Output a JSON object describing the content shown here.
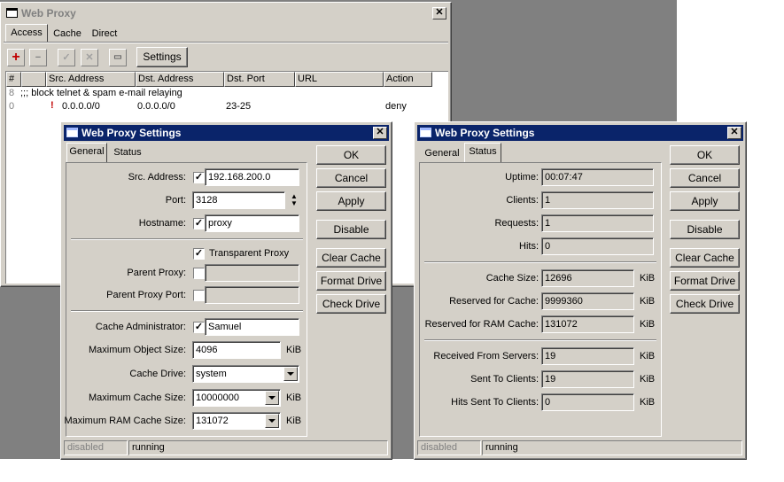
{
  "main_window": {
    "title": "Web Proxy",
    "tabs": [
      "Access",
      "Cache",
      "Direct"
    ],
    "settings_button": "Settings",
    "columns": [
      "#",
      "Src. Address",
      "Dst. Address",
      "Dst. Port",
      "URL",
      "Action"
    ],
    "comment_row": ";;; block telnet & spam e-mail relaying",
    "rows": [
      {
        "num": "0",
        "src": "0.0.0.0/0",
        "dst": "0.0.0.0/0",
        "port": "23-25",
        "url": "",
        "action": "deny"
      }
    ]
  },
  "settings_general": {
    "title": "Web Proxy Settings",
    "tabs": [
      "General",
      "Status"
    ],
    "src_address_label": "Src. Address:",
    "src_address": "192.168.200.0",
    "port_label": "Port:",
    "port": "3128",
    "hostname_label": "Hostname:",
    "hostname": "proxy",
    "transparent_label": "Transparent Proxy",
    "parent_proxy_label": "Parent Proxy:",
    "parent_proxy_port_label": "Parent Proxy Port:",
    "cache_admin_label": "Cache Administrator:",
    "cache_admin": "Samuel",
    "max_object_label": "Maximum Object Size:",
    "max_object": "4096",
    "cache_drive_label": "Cache Drive:",
    "cache_drive": "system",
    "max_cache_label": "Maximum Cache Size:",
    "max_cache": "10000000",
    "max_ram_label": "Maximum RAM Cache Size:",
    "max_ram": "131072",
    "unit": "KiB",
    "status_left": "disabled",
    "status_right": "running"
  },
  "settings_status": {
    "title": "Web Proxy Settings",
    "tabs": [
      "General",
      "Status"
    ],
    "uptime_label": "Uptime:",
    "uptime": "00:07:47",
    "clients_label": "Clients:",
    "clients": "1",
    "requests_label": "Requests:",
    "requests": "1",
    "hits_label": "Hits:",
    "hits": "0",
    "cache_size_label": "Cache Size:",
    "cache_size": "12696",
    "reserved_label": "Reserved for Cache:",
    "reserved": "9999360",
    "reserved_ram_label": "Reserved for RAM Cache:",
    "reserved_ram": "131072",
    "received_label": "Received From Servers:",
    "received": "19",
    "sent_label": "Sent To Clients:",
    "sent": "19",
    "hits_sent_label": "Hits Sent To Clients:",
    "hits_sent": "0",
    "unit": "KiB",
    "status_left": "disabled",
    "status_right": "running"
  },
  "buttons": {
    "ok": "OK",
    "cancel": "Cancel",
    "apply": "Apply",
    "disable": "Disable",
    "clear_cache": "Clear Cache",
    "format_drive": "Format Drive",
    "check_drive": "Check Drive"
  },
  "check_mark": "✓",
  "close_glyph": "✕"
}
